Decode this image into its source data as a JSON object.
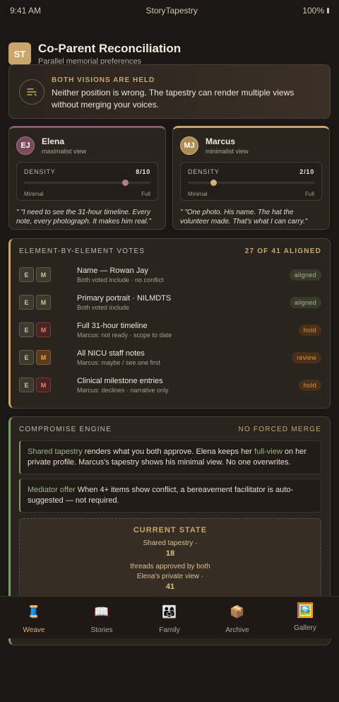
{
  "status_bar": {
    "time": "9:41 AM",
    "app": "StoryTapestry",
    "battery": "100%"
  },
  "header": {
    "logo": "ST",
    "title": "Co-Parent Reconciliation",
    "subtitle": "Parallel memorial preferences"
  },
  "banner": {
    "icon": "balance-lines-icon",
    "kicker": "BOTH VISIONS ARE HELD",
    "text": "Neither position is wrong. The tapestry can render multiple views without merging your voices."
  },
  "parents": [
    {
      "initials": "EJ",
      "name": "Elena",
      "view": "maximalist view",
      "density_label": "DENSITY",
      "density_value": "8/10",
      "density": 0.8,
      "min_label": "Minimal",
      "max_label": "Full",
      "quote": "\" \"I need to see the 31-hour timeline. Every note, every photograph. It makes him real.\""
    },
    {
      "initials": "MJ",
      "name": "Marcus",
      "view": "minimalist view",
      "density_label": "DENSITY",
      "density_value": "2/10",
      "density": 0.2,
      "min_label": "Minimal",
      "max_label": "Full",
      "quote": "\" \"One photo. His name. The hat the volunteer made. That's what I can carry.\""
    }
  ],
  "votes": {
    "title": "ELEMENT-BY-ELEMENT VOTES",
    "summary": "27 OF 41 ALIGNED",
    "items": [
      {
        "e": "E",
        "m": "M",
        "m_state": "g",
        "name": "Name — Rowan Jay",
        "sub": "Both voted include · no conflict",
        "badge": "aligned"
      },
      {
        "e": "E",
        "m": "M",
        "m_state": "g",
        "name": "Primary portrait · NILMDTS",
        "sub": "Both voted include",
        "badge": "aligned"
      },
      {
        "e": "E",
        "m": "M",
        "m_state": "r",
        "name": "Full 31-hour timeline",
        "sub": "Marcus: not ready · scope to date",
        "badge": "hold"
      },
      {
        "e": "E",
        "m": "M",
        "m_state": "o",
        "name": "All NICU staff notes",
        "sub": "Marcus: maybe / see one first",
        "badge": "review"
      },
      {
        "e": "E",
        "m": "M",
        "m_state": "r",
        "name": "Clinical milestone entries",
        "sub": "Marcus: declines · narrative only",
        "badge": "hold"
      }
    ]
  },
  "engine": {
    "title": "COMPROMISE ENGINE",
    "tag": "NO FORCED MERGE",
    "note1": {
      "lead": "Shared tapestry",
      "a": " renders what you both approve. Elena keeps her ",
      "hl": "full-view",
      "b": " on her private profile. Marcus's tapestry shows his minimal view. No one overwrites."
    },
    "note2": {
      "lead": "Mediator offer",
      "a": " When 4+ items show conflict, a bereavement facilitator is auto-suggested — not required."
    },
    "state": {
      "title": "CURRENT STATE",
      "line1": "Shared tapestry ·",
      "num1": "18",
      "line2": "threads approved by both",
      "line3": "Elena's private view ·",
      "num2": "41"
    }
  },
  "tabs": [
    {
      "label": "Weave",
      "icon": "🧵",
      "active": true
    },
    {
      "label": "Stories",
      "icon": "📖"
    },
    {
      "label": "Family",
      "icon": "👨‍👩‍👧"
    },
    {
      "label": "Archive",
      "icon": "📦"
    },
    {
      "label": "Gallery",
      "icon": "🖼️"
    }
  ]
}
